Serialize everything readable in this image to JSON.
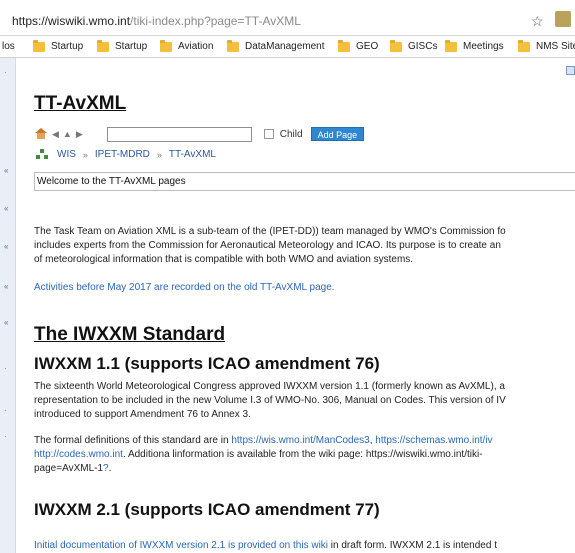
{
  "browser": {
    "url_host": "https://wiswiki.wmo.int",
    "url_path": "/tiki-index.php?page=TT-AvXML",
    "bookmarks": [
      "los",
      "Startup",
      "Startup",
      "Aviation",
      "DataManagement",
      "GEO",
      "GISCs",
      "Meetings",
      "NMS Sites"
    ]
  },
  "page": {
    "title": "TT-AvXML",
    "toolbar": {
      "child_label": "Child",
      "add_page_label": "Add Page",
      "search_value": ""
    },
    "breadcrumb": [
      "WIS",
      "IPET-MDRD",
      "TT-AvXML"
    ],
    "breadcrumb_sep": "»",
    "welcome": "Welcome to the TT-AvXML pages",
    "intro_lines": [
      "The Task Team on Aviation XML is a sub-team of the (IPET-DD)) team managed by WMO's Commission fo",
      "includes experts from the Commission for Aeronautical Meteorology and ICAO. Its purpose is to create an",
      "of meteorological information that is compatible with both WMO and aviation systems."
    ],
    "activities_link": "Activities before May 2017 are recorded on the old TT-AvXML page.",
    "standard_heading": "The IWXXM Standard",
    "v11": {
      "heading": "IWXXM 1.1 (supports ICAO amendment 76)",
      "lines": [
        "The sixteenth World Meteorological Congress approved IWXXM version 1.1 (formerly known as AvXML), a",
        "representation to be included in the new Volume I.3 of WMO-No. 306, Manual on Codes. This version of IV",
        "introduced to support Amendment 76 to Annex 3."
      ],
      "defs_text_1": "The formal definitions of this standard are in ",
      "defs_link_1": "https://wis.wmo.int/ManCodes3",
      "defs_comma": ", ",
      "defs_link_2": "https://schemas.wmo.int/iv",
      "defs_link_3": "http://codes.wmo.int",
      "defs_text_2": ". Additiona linformation is available from the wiki page: https://wiswiki.wmo.int/tiki-",
      "defs_text_3": "page=AvXML-1",
      "defs_link_4": "?",
      "defs_text_4": "."
    },
    "v21": {
      "heading": "IWXXM 2.1 (supports ICAO amendment 77)",
      "link": "Initial documentation of IWXXM version 2.1 is provided on this wiki",
      "rest": " in draft form. IWXXM 2.1 is intended t"
    }
  }
}
